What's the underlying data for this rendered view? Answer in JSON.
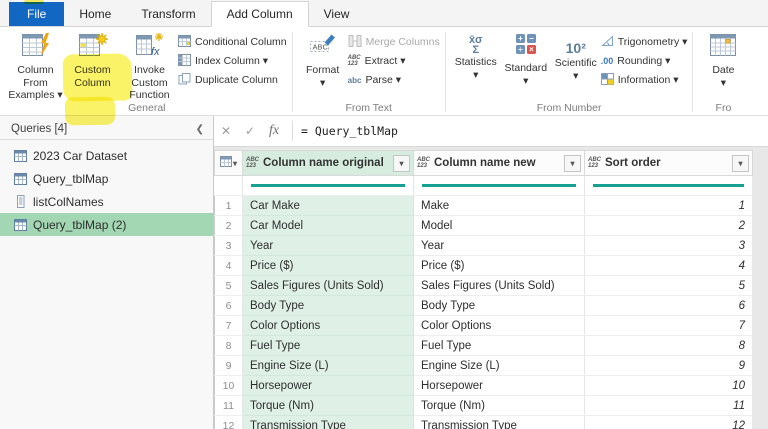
{
  "tabs": {
    "file": "File",
    "home": "Home",
    "transform": "Transform",
    "add_column": "Add Column",
    "view": "View"
  },
  "ribbon": {
    "general": {
      "label": "General",
      "column_from_examples": "Column From\nExamples ▾",
      "custom_column": "Custom\nColumn",
      "invoke_custom_function": "Invoke Custom\nFunction",
      "conditional_column": "Conditional Column",
      "index_column": "Index Column ▾",
      "duplicate_column": "Duplicate Column"
    },
    "from_text": {
      "label": "From Text",
      "format": "Format\n▾",
      "merge_columns": "Merge Columns",
      "extract": "Extract ▾",
      "parse": "Parse ▾"
    },
    "from_number": {
      "label": "From Number",
      "statistics": "Statistics\n▾",
      "standard": "Standard\n▾",
      "scientific": "Scientific\n▾",
      "trigonometry": "Trigonometry ▾",
      "rounding": "Rounding ▾",
      "information": "Information ▾"
    },
    "from_date": {
      "label": "Fro",
      "date": "Date\n▾"
    }
  },
  "glyphs": {
    "dropdown": "▾",
    "collapse": "❮",
    "cancel": "✕",
    "check": "✓",
    "fx": "fx",
    "abc": "ABC",
    "num123": "123",
    "abc_lower": "abc",
    "stat_top": "x̄σ",
    "stat_bottom": "Σ",
    "scientific": "10²",
    "rounding": ".00"
  },
  "queries": {
    "header": "Queries [4]",
    "items": [
      {
        "name": "2023 Car Dataset",
        "icon": "table",
        "selected": false
      },
      {
        "name": "Query_tblMap",
        "icon": "table",
        "selected": false
      },
      {
        "name": "listColNames",
        "icon": "list",
        "selected": false
      },
      {
        "name": "Query_tblMap (2)",
        "icon": "table",
        "selected": true
      }
    ]
  },
  "formula": {
    "value": "= Query_tblMap"
  },
  "grid": {
    "columns": [
      {
        "name": "Column name original",
        "selected": true
      },
      {
        "name": "Column name new",
        "selected": false
      },
      {
        "name": "Sort order",
        "selected": false
      }
    ],
    "rows": [
      {
        "n": 1,
        "original": "Car Make",
        "new_name": "Make",
        "sort": 1
      },
      {
        "n": 2,
        "original": "Car Model",
        "new_name": "Model",
        "sort": 2
      },
      {
        "n": 3,
        "original": "Year",
        "new_name": "Year",
        "sort": 3
      },
      {
        "n": 4,
        "original": "Price ($)",
        "new_name": "Price ($)",
        "sort": 4
      },
      {
        "n": 5,
        "original": "Sales Figures (Units Sold)",
        "new_name": "Sales Figures (Units Sold)",
        "sort": 5
      },
      {
        "n": 6,
        "original": "Body Type",
        "new_name": "Body Type",
        "sort": 6
      },
      {
        "n": 7,
        "original": "Color Options",
        "new_name": "Color Options",
        "sort": 7
      },
      {
        "n": 8,
        "original": "Fuel Type",
        "new_name": "Fuel Type",
        "sort": 8
      },
      {
        "n": 9,
        "original": "Engine Size (L)",
        "new_name": "Engine Size (L)",
        "sort": 9
      },
      {
        "n": 10,
        "original": "Horsepower",
        "new_name": "Horsepower",
        "sort": 10
      },
      {
        "n": 11,
        "original": "Torque (Nm)",
        "new_name": "Torque (Nm)",
        "sort": 11
      },
      {
        "n": 12,
        "original": "Transmission Type",
        "new_name": "Transmission Type",
        "sort": 12
      }
    ]
  },
  "colors": {
    "file_tab_blue": "#1267c2",
    "selection_green": "#a3d7b4",
    "column_tint_green": "#dff0e6",
    "header_tint_green": "#d6ecdf",
    "quality_bar_teal": "#16a292",
    "highlight_yellow": "#f8ec0a",
    "disabled_gray": "#a9a9a9"
  }
}
